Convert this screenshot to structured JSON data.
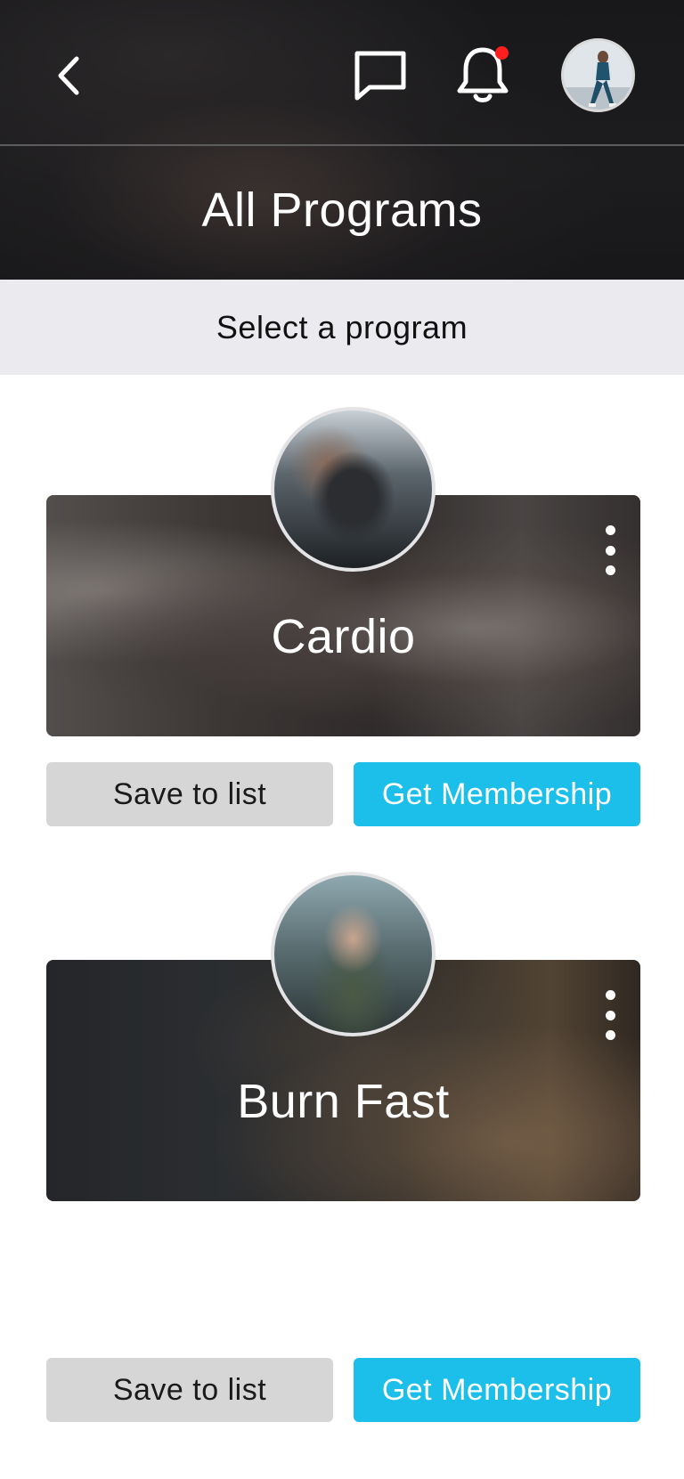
{
  "header": {
    "title": "All Programs",
    "back_icon": "chevron-left-icon",
    "chat_icon": "chat-bubble-icon",
    "notification_icon": "bell-icon",
    "notification_dot_color": "#ff1e1e",
    "avatar_icon": "user-avatar"
  },
  "subheader": {
    "label": "Select a program"
  },
  "programs": [
    {
      "title": "Cardio",
      "menu_icon": "more-vertical-icon",
      "save_label": "Save to list",
      "membership_label": "Get Membership"
    },
    {
      "title": "Burn Fast",
      "menu_icon": "more-vertical-icon",
      "save_label": "Save to list",
      "membership_label": "Get Membership"
    }
  ],
  "colors": {
    "accent": "#1bbfea",
    "secondary_button": "#d6d6d6",
    "subheader_bg": "#ebebef"
  }
}
